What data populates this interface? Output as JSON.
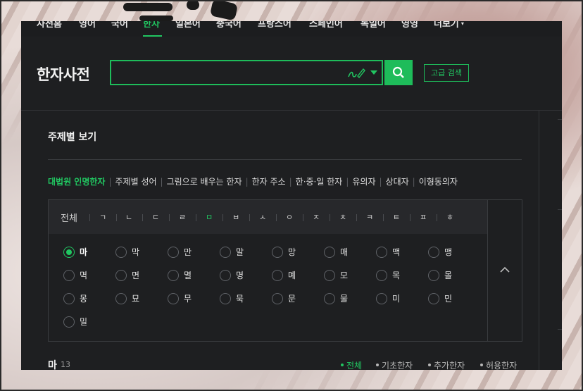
{
  "colors": {
    "accent": "#21c661",
    "background": "#1e1f21",
    "panel": "#27282b"
  },
  "nav": {
    "items": [
      {
        "label": "사전홈"
      },
      {
        "label": "영어"
      },
      {
        "label": "국어"
      },
      {
        "label": "한자",
        "active": true
      },
      {
        "label": "일본어"
      },
      {
        "label": "중국어"
      },
      {
        "label": "프랑스어"
      },
      {
        "label": "스페인어"
      },
      {
        "label": "독일어"
      },
      {
        "label": "영영"
      },
      {
        "label": "더보기"
      }
    ]
  },
  "header": {
    "title": "한자사전",
    "search": {
      "value": "",
      "placeholder": ""
    },
    "advanced_search": "고급 검색"
  },
  "panel": {
    "title": "주제별 보기",
    "topics": [
      "대법원 인명한자",
      "주제별 성어",
      "그림으로 배우는 한자",
      "한자 주소",
      "한·중·일 한자",
      "유의자",
      "상대자",
      "이형동의자"
    ],
    "consonants": {
      "all": "전체",
      "items": [
        "ㄱ",
        "ㄴ",
        "ㄷ",
        "ㄹ",
        "ㅁ",
        "ㅂ",
        "ㅅ",
        "ㅇ",
        "ㅈ",
        "ㅊ",
        "ㅋ",
        "ㅌ",
        "ㅍ",
        "ㅎ"
      ],
      "active": "ㅁ"
    },
    "syllables": [
      "마",
      "막",
      "만",
      "말",
      "망",
      "매",
      "맥",
      "맹",
      "멱",
      "면",
      "멸",
      "명",
      "몌",
      "모",
      "목",
      "몰",
      "몽",
      "묘",
      "무",
      "묵",
      "문",
      "물",
      "미",
      "민",
      "밀"
    ],
    "selected_syllable": "마",
    "result": {
      "char": "마",
      "count": "13",
      "filters": [
        "전체",
        "기초한자",
        "추가한자",
        "허용한자"
      ],
      "active_filter": "전체"
    }
  }
}
